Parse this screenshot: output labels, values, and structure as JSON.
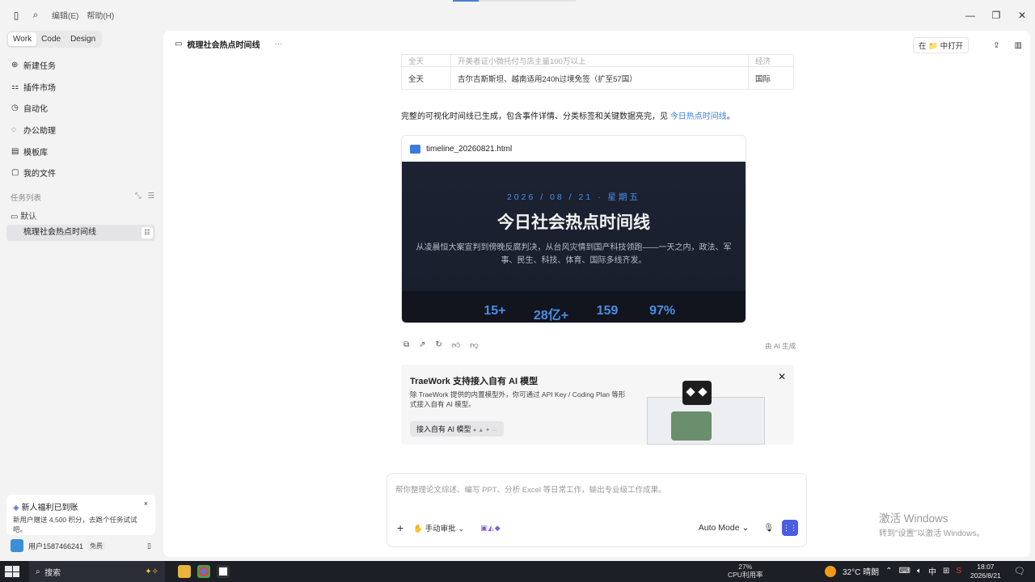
{
  "menu": {
    "edit": "编辑(E)",
    "help": "帮助(H)"
  },
  "sidebar": {
    "modes": [
      "Work",
      "Code",
      "Design"
    ],
    "nav": [
      {
        "icon": "plus-circle-icon",
        "label": "新建任务"
      },
      {
        "icon": "plugin-icon",
        "label": "插件市场"
      },
      {
        "icon": "clock-icon",
        "label": "自动化"
      },
      {
        "icon": "chat-icon",
        "label": "办公助理"
      },
      {
        "icon": "template-icon",
        "label": "模板库"
      },
      {
        "icon": "folder-icon",
        "label": "我的文件"
      }
    ],
    "tasks_header": "任务列表",
    "folder": "默认",
    "task": "梳理社会热点时间线",
    "promo": {
      "title": "新人福利已到账",
      "desc": "新用户赠送 4,500 积分，去跑个任务试试吧。"
    },
    "user": {
      "name": "用户1587466241",
      "badge": "免费"
    }
  },
  "doc": {
    "title": "梳理社会热点时间线",
    "open_in": "在 📁 中打开"
  },
  "table": {
    "rows": [
      {
        "time": "全天",
        "event": "开美者证小微托付与店主量100万以上",
        "cat": "经济",
        "faint": true
      },
      {
        "time": "全天",
        "event": "吉尔吉斯斯坦、越南适用240h过境免签（扩至57国）",
        "cat": "国际",
        "faint": false
      }
    ]
  },
  "summary": {
    "text": "完整的可视化时间线已生成，包含事件详情、分类标签和关键数据亮完，见",
    "link": "今日热点时间线",
    "end": "。"
  },
  "file": {
    "name": "timeline_20260821.html",
    "date": "2026 / 08 / 21 · 星期五",
    "title": "今日社会热点时间线",
    "desc": "从凌晨恒大案宣判到傍晚反腐判决，从台风灾情到国产科技领跑——一天之内，政法、军事、民生、科技、体育、国际多线齐发。",
    "stats": [
      "15+",
      "28亿+",
      "159",
      "97%"
    ]
  },
  "ai_generated": "由 AI 生成",
  "banner": {
    "title": "TraeWork 支持接入自有 AI 模型",
    "desc": "除 TraeWork 提供的内置模型外，你可通过 API Key / Coding Plan 等形式接入自有 AI 模型。",
    "button": "接入自有 AI 模型"
  },
  "composer": {
    "placeholder": "帮你整理论文综述、编写 PPT、分析 Excel 等日常工作，输出专业级工作成果。",
    "approve": "手动审批",
    "mode": "Auto Mode"
  },
  "watermark": {
    "line1": "激活 Windows",
    "line2": "转到\"设置\"以激活 Windows。"
  },
  "taskbar": {
    "search": "搜索",
    "cpu_pct": "27%",
    "cpu_label": "CPU利用率",
    "weather": "32°C 晴朗",
    "ime": "中",
    "time": "18:07",
    "date": "2026/8/21"
  }
}
